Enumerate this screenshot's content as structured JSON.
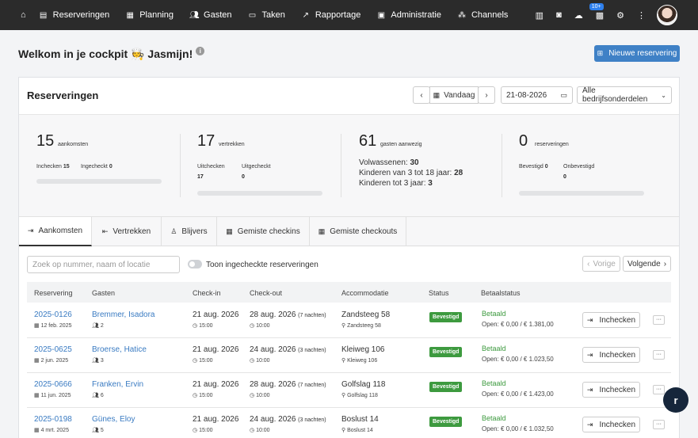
{
  "nav": {
    "items": [
      {
        "label": "Reserveringen",
        "icon": "book-icon"
      },
      {
        "label": "Planning",
        "icon": "calendar-icon"
      },
      {
        "label": "Gasten",
        "icon": "users-icon"
      },
      {
        "label": "Taken",
        "icon": "clipboard-icon"
      },
      {
        "label": "Rapportage",
        "icon": "chart-icon"
      },
      {
        "label": "Administratie",
        "icon": "invoice-icon"
      },
      {
        "label": "Channels",
        "icon": "network-icon"
      }
    ],
    "badge": "10+"
  },
  "welcome": {
    "text": "Welkom in je cockpit 🧑‍🍳 Jasmijn!"
  },
  "new_reservation_label": "Nieuwe reservering",
  "card": {
    "title": "Reserveringen",
    "today_label": "Vandaag",
    "date_value": "21-08-2026",
    "dept_label": "Alle bedrijfsonderdelen"
  },
  "stats": {
    "arrivals": {
      "value": "15",
      "label": "aankomsten",
      "checkin_label": "Inchecken",
      "checkin_value": "15",
      "checkedin_label": "Ingecheckt",
      "checkedin_value": "0"
    },
    "departures": {
      "value": "17",
      "label": "vertrekken",
      "checkout_label": "Uitchecken",
      "checkout_value": "17",
      "checkedout_label": "Uitgecheckt",
      "checkedout_value": "0"
    },
    "guests": {
      "value": "61",
      "label": "gasten aanwezig",
      "adults_label": "Volwassenen:",
      "adults_value": "30",
      "kids_label": "Kinderen van 3 tot 18 jaar:",
      "kids_value": "28",
      "toddlers_label": "Kinderen tot 3 jaar:",
      "toddlers_value": "3"
    },
    "reservations": {
      "value": "0",
      "label": "reserveringen",
      "confirmed_label": "Bevestigd",
      "confirmed_value": "0",
      "unconfirmed_label": "Onbevestigd",
      "unconfirmed_value": "0"
    }
  },
  "tabs": [
    "Aankomsten",
    "Vertrekken",
    "Blijvers",
    "Gemiste checkins",
    "Gemiste checkouts"
  ],
  "search_placeholder": "Zoek op nummer, naam of locatie",
  "toggle_label": "Toon ingecheckte reserveringen",
  "pager": {
    "prev": "Vorige",
    "next": "Volgende"
  },
  "table": {
    "headers": [
      "Reservering",
      "Gasten",
      "Check-in",
      "Check-out",
      "Accommodatie",
      "Status",
      "Betaalstatus"
    ],
    "rows": [
      {
        "res_no": "2025-0126",
        "res_date": "12 feb. 2025",
        "guest": "Bremmer, Isadora",
        "count": "2",
        "checkin": "21 aug. 2026",
        "checkin_time": "15:00",
        "checkout": "28 aug. 2026",
        "nights": "(7 nachten)",
        "checkout_time": "10:00",
        "acc": "Zandsteeg 58",
        "acc_sub": "Zandsteeg 58",
        "status": "Bevestigd",
        "pay": "Betaald",
        "open": "Open: € 0,00 / € 1.381,00",
        "action": "Inchecken"
      },
      {
        "res_no": "2025-0625",
        "res_date": "2 jun. 2025",
        "guest": "Broerse, Hatice",
        "count": "3",
        "checkin": "21 aug. 2026",
        "checkin_time": "15:00",
        "checkout": "24 aug. 2026",
        "nights": "(3 nachten)",
        "checkout_time": "10:00",
        "acc": "Kleiweg 106",
        "acc_sub": "Kleiweg 106",
        "status": "Bevestigd",
        "pay": "Betaald",
        "open": "Open: € 0,00 / € 1.023,50",
        "action": "Inchecken"
      },
      {
        "res_no": "2025-0666",
        "res_date": "11 jun. 2025",
        "guest": "Franken, Ervin",
        "count": "6",
        "checkin": "21 aug. 2026",
        "checkin_time": "15:00",
        "checkout": "28 aug. 2026",
        "nights": "(7 nachten)",
        "checkout_time": "10:00",
        "acc": "Golfslag 118",
        "acc_sub": "Golfslag 118",
        "status": "Bevestigd",
        "pay": "Betaald",
        "open": "Open: € 0,00 / € 1.423,00",
        "action": "Inchecken"
      },
      {
        "res_no": "2025-0198",
        "res_date": "4 mrt. 2025",
        "guest": "Günes, Eloy",
        "count": "5",
        "checkin": "21 aug. 2026",
        "checkin_time": "15:00",
        "checkout": "24 aug. 2026",
        "nights": "(3 nachten)",
        "checkout_time": "10:00",
        "acc": "Boslust 14",
        "acc_sub": "Boslust 14",
        "status": "Bevestigd",
        "pay": "Betaald",
        "open": "Open: € 0,00 / € 1.032,50",
        "action": "Inchecken"
      }
    ]
  }
}
